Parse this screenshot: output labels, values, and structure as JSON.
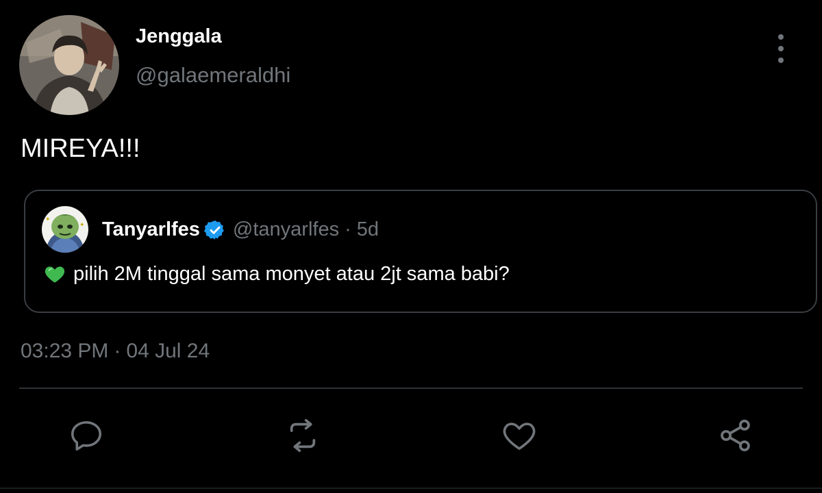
{
  "tweet": {
    "author_name": "Jenggala",
    "author_handle": "@galaemeraldhi",
    "text": "MIREYA!!!",
    "time": "03:23 PM",
    "separator": "·",
    "date": "04 Jul 24"
  },
  "quoted": {
    "name": "Tanyarlfes",
    "handle": "@tanyarlfes",
    "separator": "·",
    "age": "5d",
    "emoji": "green-heart",
    "text": "pilih 2M tinggal sama monyet atau 2jt sama babi?",
    "verified": true
  },
  "actions": [
    "reply-icon",
    "retweet-icon",
    "like-icon",
    "share-icon"
  ],
  "colors": {
    "background": "#000000",
    "primary_text": "#ffffff",
    "secondary_text": "#71767b",
    "border": "#3a3d41",
    "verified_blue": "#1d9bf0",
    "emoji_green": "#3fb950"
  }
}
